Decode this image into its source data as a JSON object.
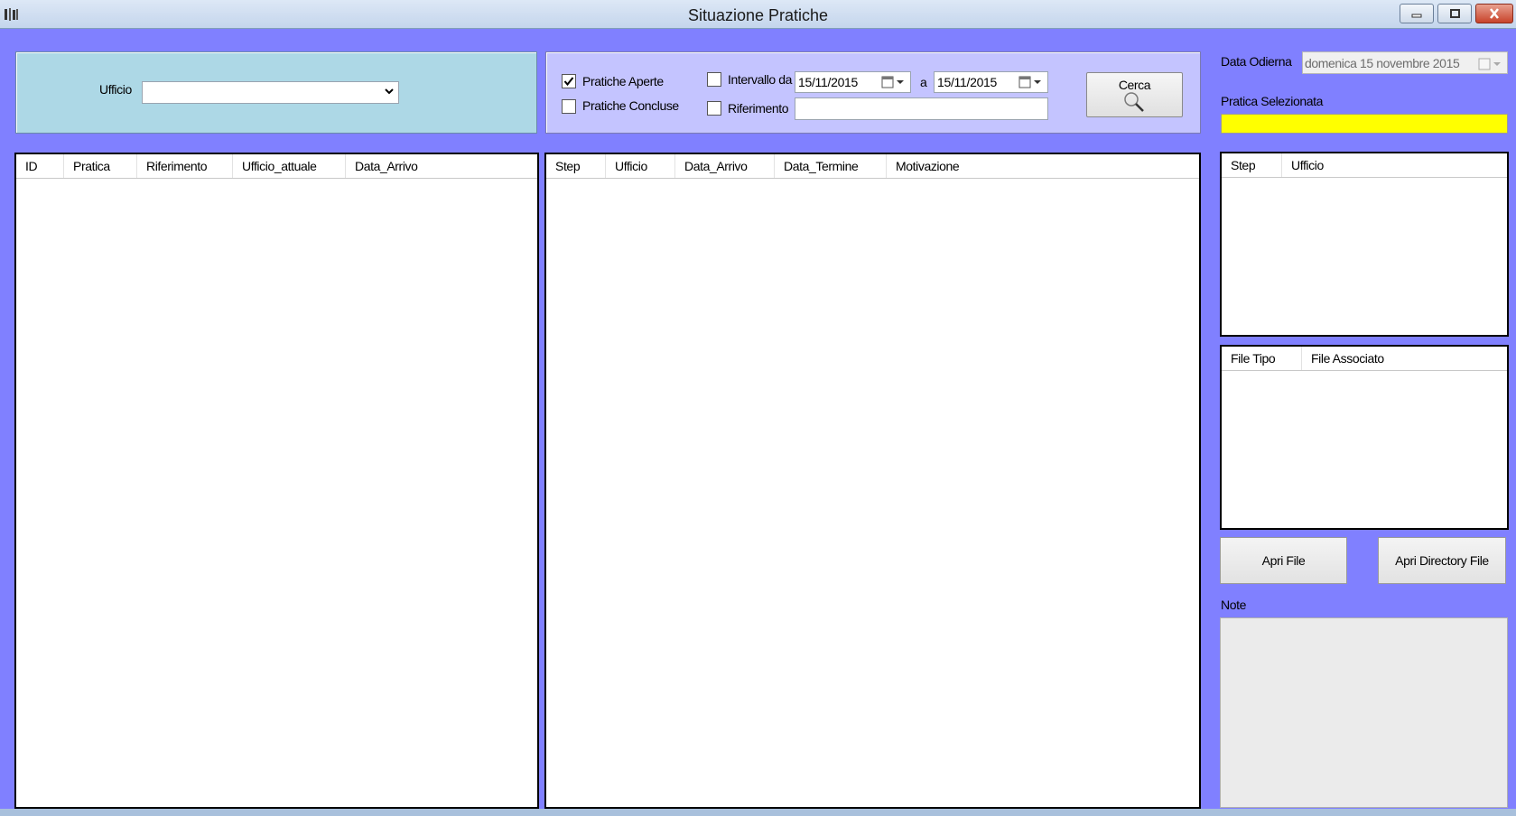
{
  "window": {
    "title": "Situazione Pratiche",
    "controls": [
      "minimize",
      "maximize",
      "close"
    ]
  },
  "ufficio_panel": {
    "label": "Ufficio",
    "selected_value": ""
  },
  "filter_panel": {
    "pratiche_aperte": {
      "label": "Pratiche Aperte",
      "checked": true
    },
    "pratiche_concluse": {
      "label": "Pratiche Concluse",
      "checked": false
    },
    "intervallo": {
      "label": "Intervallo da",
      "checked": false
    },
    "date_from": "15/11/2015",
    "to_label": "a",
    "date_to": "15/11/2015",
    "riferimento": {
      "label": "Riferimento",
      "checked": false,
      "value": ""
    },
    "search_button": {
      "label": "Cerca",
      "icon": "magnifier-icon"
    }
  },
  "pratiche_list": {
    "columns": [
      "ID",
      "Pratica",
      "Riferimento",
      "Ufficio_attuale",
      "Data_Arrivo"
    ],
    "rows": []
  },
  "steps_list": {
    "columns": [
      "Step",
      "Ufficio",
      "Data_Arrivo",
      "Data_Termine",
      "Motivazione"
    ],
    "rows": []
  },
  "right_panel": {
    "data_odierna_label": "Data Odierna",
    "data_odierna_value": "domenica 15 novembre 2015",
    "pratica_selezionata_label": "Pratica Selezionata",
    "pratica_selezionata_value": "",
    "highlight_color": "#ffff00",
    "step_list": {
      "columns": [
        "Step",
        "Ufficio"
      ],
      "rows": []
    },
    "file_list": {
      "columns": [
        "File Tipo",
        "File Associato"
      ],
      "rows": []
    },
    "apri_file_label": "Apri File",
    "apri_directory_label": "Apri Directory File",
    "note_label": "Note",
    "note_value": ""
  },
  "colors": {
    "form_background": "#8080ff",
    "ufficio_panel": "#add8e6",
    "filter_panel": "#c4c4ff"
  }
}
